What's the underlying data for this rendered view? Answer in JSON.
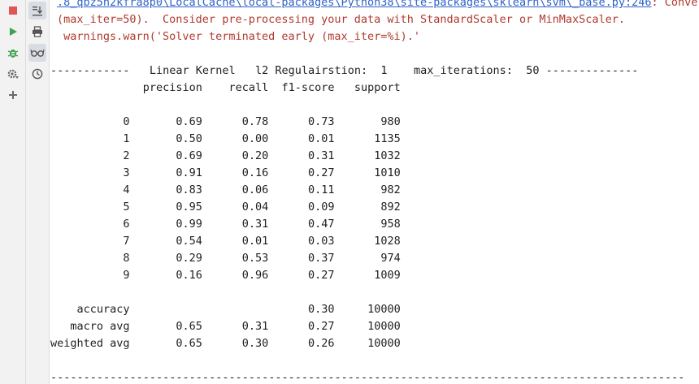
{
  "toolbar": {
    "left": [
      {
        "name": "stop-icon",
        "interactable": true
      },
      {
        "name": "run-icon",
        "interactable": true
      },
      {
        "name": "debug-icon",
        "interactable": true
      },
      {
        "name": "settings-icon",
        "interactable": true
      },
      {
        "name": "add-icon",
        "interactable": true
      }
    ],
    "second": [
      {
        "name": "scroll-to-end-icon",
        "interactable": true,
        "active": true
      },
      {
        "name": "print-icon",
        "interactable": true
      },
      {
        "name": "glasses-icon",
        "interactable": true,
        "active": true
      },
      {
        "name": "history-icon",
        "interactable": true
      }
    ]
  },
  "console": {
    "warning_path_prefix": ".8_qbz5n2kfra8p0\\LocalCache\\local-packages\\Python38\\site-packages\\sklearn\\svm\\_base.py:246",
    "warning_path_suffix": ": Converg",
    "warning_line2": "(max_iter=50).  Consider pre-processing your data with StandardScaler or MinMaxScaler.",
    "warning_line3": " warnings.warn('Solver terminated early (max_iter=%i).'",
    "header_line": "------------   Linear Kernel   l2 Regulairstion:  1    max_iterations:  50 --------------",
    "report_header": "              precision    recall  f1-score   support",
    "rows": [
      "           0       0.69      0.78      0.73       980",
      "           1       0.50      0.00      0.01      1135",
      "           2       0.69      0.20      0.31      1032",
      "           3       0.91      0.16      0.27      1010",
      "           4       0.83      0.06      0.11       982",
      "           5       0.95      0.04      0.09       892",
      "           6       0.99      0.31      0.47       958",
      "           7       0.54      0.01      0.03      1028",
      "           8       0.29      0.53      0.37       974",
      "           9       0.16      0.96      0.27      1009"
    ],
    "accuracy_line": "    accuracy                           0.30     10000",
    "macro_line": "   macro avg       0.65      0.31      0.27     10000",
    "weighted_line": "weighted avg       0.65      0.30      0.26     10000",
    "footer_separator": "----------------------------------------------------------------------------------------------------"
  },
  "colors": {
    "error_text": "#b03a2e",
    "link_text": "#2f62c8",
    "stop_red": "#e05555",
    "run_green": "#3fa34d"
  }
}
